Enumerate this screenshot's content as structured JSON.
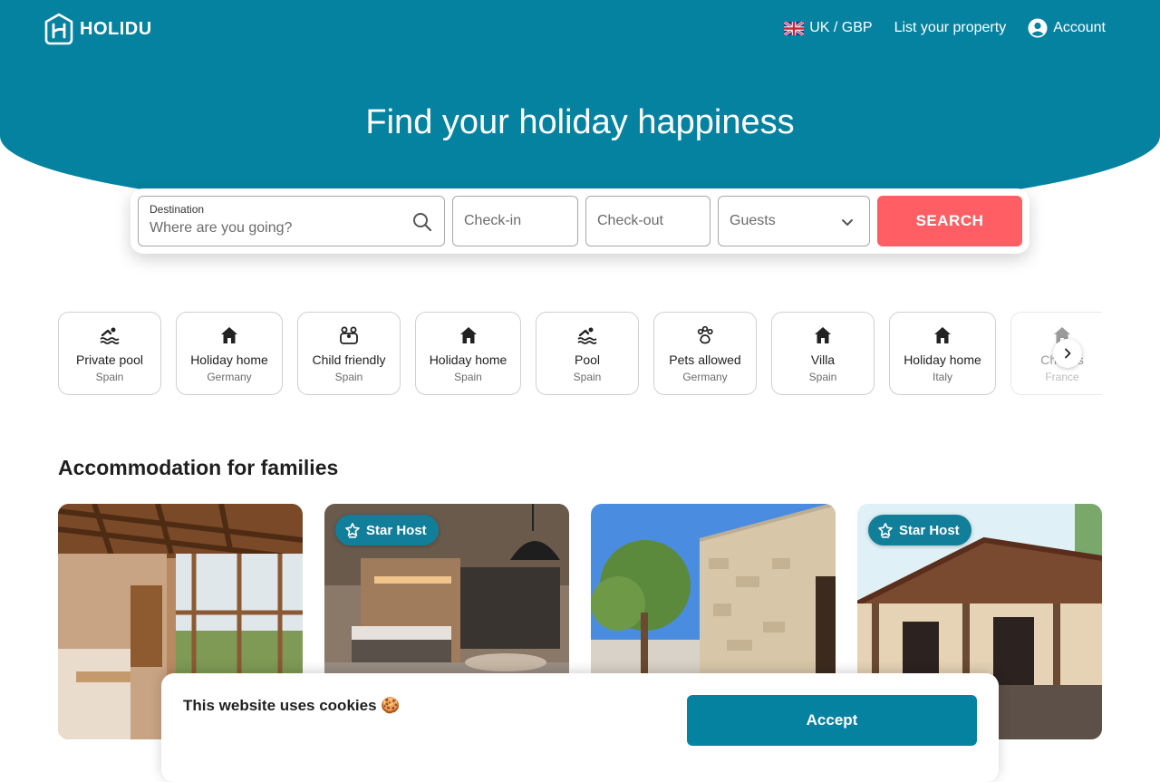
{
  "brand": {
    "name": "HOLIDU"
  },
  "colors": {
    "primary": "#0582a0",
    "search_button": "#ff5f64",
    "badge": "#127f9a"
  },
  "nav": {
    "locale": "UK / GBP",
    "list_property": "List your property",
    "account": "Account"
  },
  "hero": {
    "title": "Find your holiday happiness"
  },
  "search": {
    "destination_label": "Destination",
    "destination_placeholder": "Where are you going?",
    "checkin": "Check-in",
    "checkout": "Check-out",
    "guests": "Guests",
    "button": "SEARCH"
  },
  "categories": [
    {
      "label": "Private pool",
      "sub": "Spain",
      "icon": "pool-icon"
    },
    {
      "label": "Holiday home",
      "sub": "Germany",
      "icon": "house-icon"
    },
    {
      "label": "Child friendly",
      "sub": "Spain",
      "icon": "family-icon"
    },
    {
      "label": "Holiday home",
      "sub": "Spain",
      "icon": "house-icon"
    },
    {
      "label": "Pool",
      "sub": "Spain",
      "icon": "pool-icon"
    },
    {
      "label": "Pets allowed",
      "sub": "Germany",
      "icon": "paw-icon"
    },
    {
      "label": "Villa",
      "sub": "Spain",
      "icon": "house-icon"
    },
    {
      "label": "Holiday home",
      "sub": "Italy",
      "icon": "house-icon"
    },
    {
      "label": "Chalets",
      "sub": "France",
      "icon": "house-icon"
    }
  ],
  "section": {
    "title": "Accommodation for families"
  },
  "listings": [
    {
      "badge": ""
    },
    {
      "badge": "Star Host"
    },
    {
      "badge": ""
    },
    {
      "badge": "Star Host"
    }
  ],
  "cookie": {
    "title": "This website uses cookies 🍪",
    "accept": "Accept"
  }
}
